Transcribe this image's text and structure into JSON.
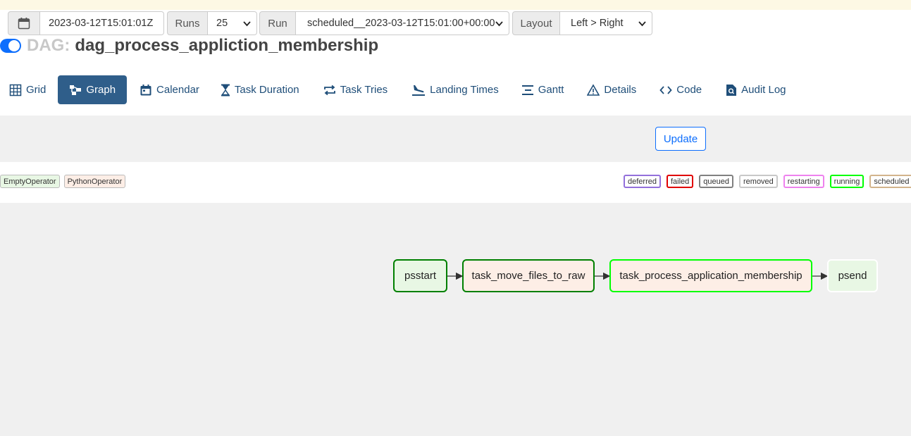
{
  "header": {
    "dag_prefix": "DAG:",
    "dag_name": "dag_process_appliction_membership"
  },
  "nav": {
    "tabs": [
      {
        "label": "Grid",
        "icon": "grid-icon",
        "active": false
      },
      {
        "label": "Graph",
        "icon": "graph-icon",
        "active": true
      },
      {
        "label": "Calendar",
        "icon": "calendar-icon",
        "active": false
      },
      {
        "label": "Task Duration",
        "icon": "hourglass-icon",
        "active": false
      },
      {
        "label": "Task Tries",
        "icon": "repeat-icon",
        "active": false
      },
      {
        "label": "Landing Times",
        "icon": "plane-landing-icon",
        "active": false
      },
      {
        "label": "Gantt",
        "icon": "gantt-icon",
        "active": false
      },
      {
        "label": "Details",
        "icon": "warning-triangle-icon",
        "active": false
      },
      {
        "label": "Code",
        "icon": "code-icon",
        "active": false
      },
      {
        "label": "Audit Log",
        "icon": "file-search-icon",
        "active": false
      }
    ]
  },
  "controls": {
    "base_date": "2023-03-12T15:01:01Z",
    "runs_label": "Runs",
    "runs_value": "25",
    "run_label": "Run",
    "run_value": "scheduled__2023-03-12T15:01:00+00:00",
    "layout_label": "Layout",
    "layout_value": "Left > Right",
    "update_label": "Update"
  },
  "operators": [
    {
      "label": "EmptyOperator",
      "bg": "#e8f7e4"
    },
    {
      "label": "PythonOperator",
      "bg": "#fdeee6"
    }
  ],
  "states": [
    {
      "label": "deferred",
      "color": "#9370db"
    },
    {
      "label": "failed",
      "color": "#e00000"
    },
    {
      "label": "queued",
      "color": "#808080"
    },
    {
      "label": "removed",
      "color": "#c8c8c8"
    },
    {
      "label": "restarting",
      "color": "#ee82ee"
    },
    {
      "label": "running",
      "color": "#00ff00"
    },
    {
      "label": "scheduled",
      "color": "#d2b48c"
    }
  ],
  "tasks": [
    {
      "label": "psstart",
      "operator": "EmptyOperator",
      "state_color": "#008000"
    },
    {
      "label": "task_move_files_to_raw",
      "operator": "PythonOperator",
      "state_color": "#008000"
    },
    {
      "label": "task_process_application_membership",
      "operator": "PythonOperator",
      "state_color": "#00ff00"
    },
    {
      "label": "psend",
      "operator": "EmptyOperator",
      "state_color": "#ffffff"
    }
  ]
}
